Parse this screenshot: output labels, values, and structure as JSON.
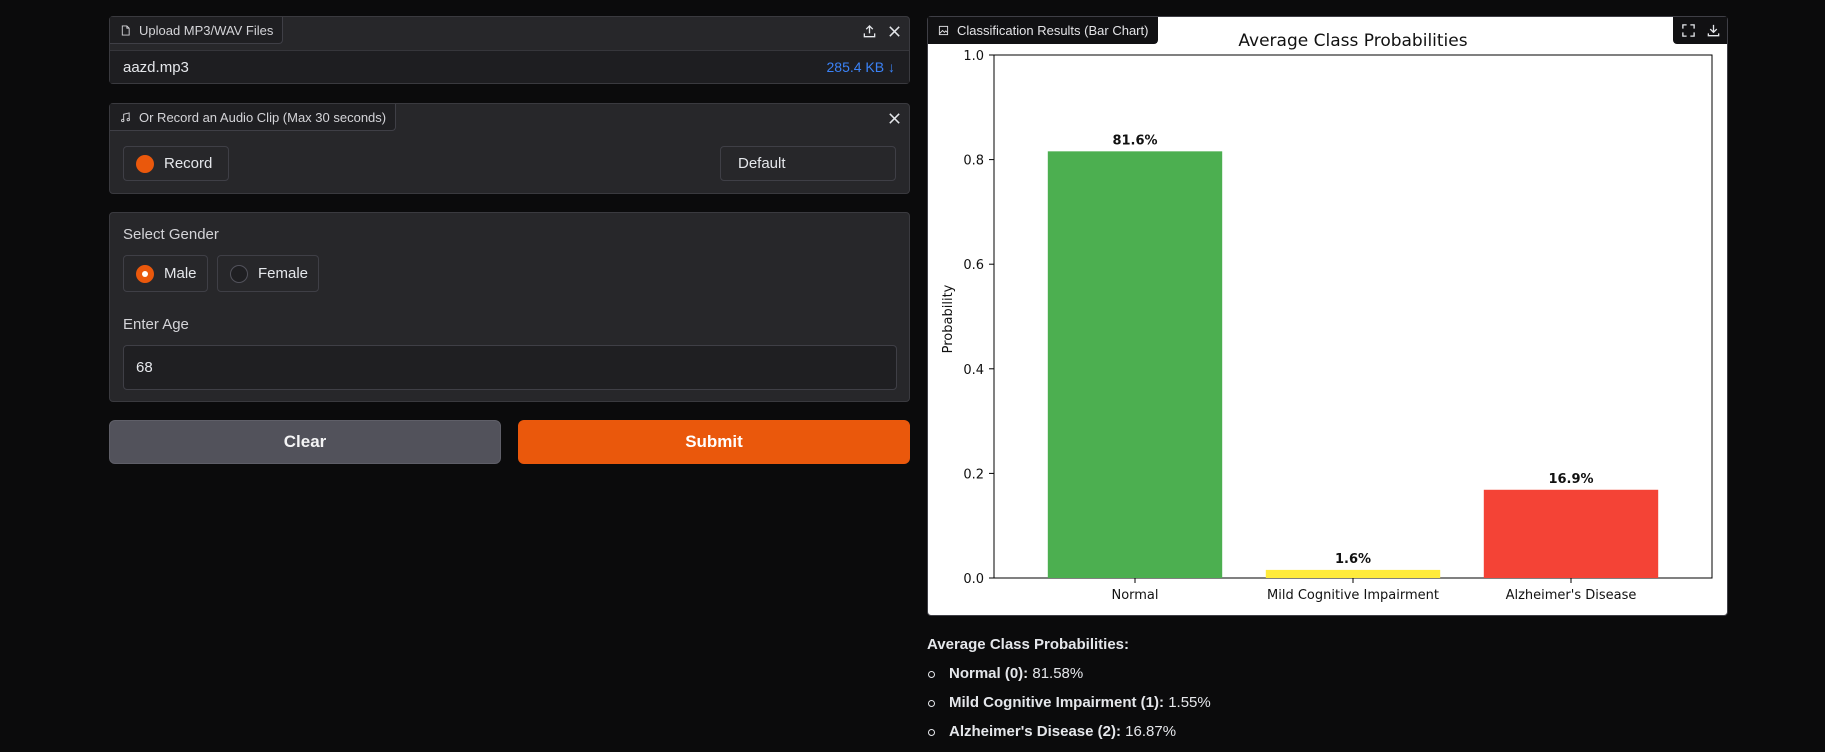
{
  "upload": {
    "label": "Upload MP3/WAV Files",
    "file_name": "aazd.mp3",
    "file_size": "285.4 KB ↓"
  },
  "record": {
    "label": "Or Record an Audio Clip (Max 30 seconds)",
    "record_button": "Record",
    "device": "Default"
  },
  "form": {
    "gender_label": "Select Gender",
    "gender_options": [
      "Male",
      "Female"
    ],
    "gender_selected": "Male",
    "age_label": "Enter Age",
    "age_value": "68"
  },
  "actions": {
    "clear": "Clear",
    "submit": "Submit"
  },
  "results": {
    "label": "Classification Results (Bar Chart)"
  },
  "summary": {
    "title": "Average Class Probabilities:",
    "items": [
      {
        "label": "Normal (0):",
        "value": "81.58%"
      },
      {
        "label": "Mild Cognitive Impairment (1):",
        "value": "1.55%"
      },
      {
        "label": "Alzheimer's Disease (2):",
        "value": "16.87%"
      }
    ]
  },
  "chart_data": {
    "type": "bar",
    "title": "Average Class Probabilities",
    "ylabel": "Probability",
    "xlabel": "",
    "categories": [
      "Normal",
      "Mild Cognitive Impairment",
      "Alzheimer's Disease"
    ],
    "values": [
      0.8158,
      0.0155,
      0.1687
    ],
    "value_labels": [
      "81.6%",
      "1.6%",
      "16.9%"
    ],
    "colors": [
      "#4caf50",
      "#ffeb3b",
      "#f44336"
    ],
    "ylim": [
      0,
      1.0
    ],
    "yticks": [
      "0.0",
      "0.2",
      "0.4",
      "0.6",
      "0.8",
      "1.0"
    ],
    "grid": false
  }
}
